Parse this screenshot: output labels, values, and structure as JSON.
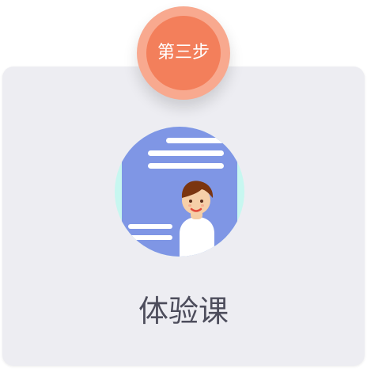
{
  "step": {
    "label": "第三步"
  },
  "card": {
    "title": "体验课",
    "illustration_icon": "resume-person-illustration"
  },
  "colors": {
    "badge_outer": "#f8a98f",
    "badge_inner": "#f37f5b",
    "card_background": "#ededf2",
    "illustration_blue": "#7f96e5",
    "illustration_aqua": "#c7f7f0",
    "title_text": "#4d4d5c"
  }
}
